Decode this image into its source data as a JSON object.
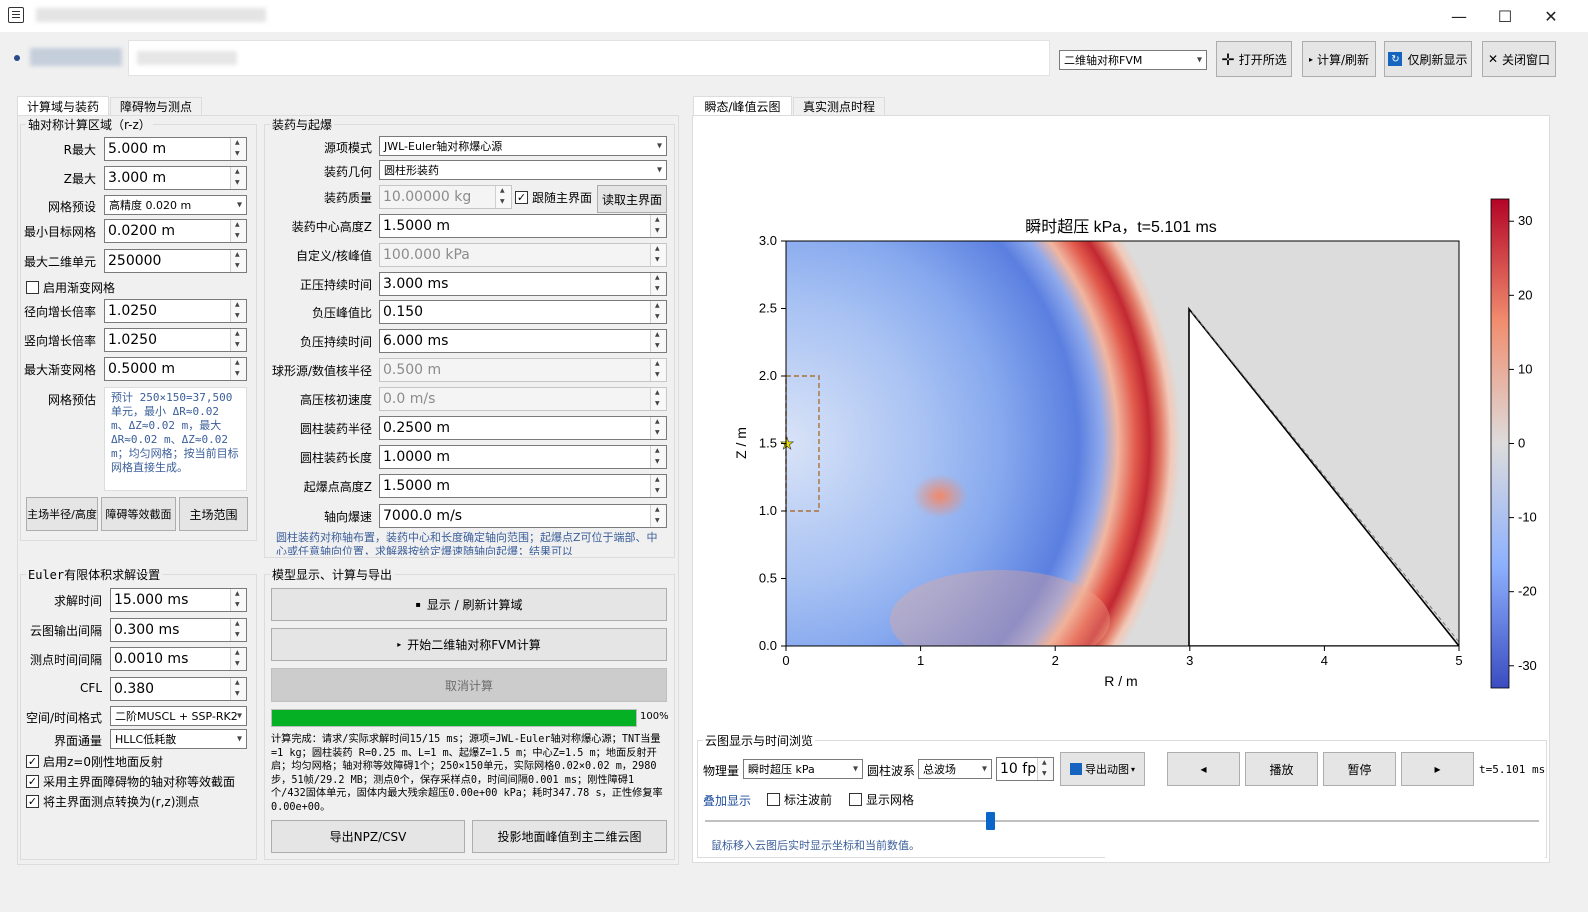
{
  "window": {
    "minimize_glyph": "—",
    "maximize_glyph": "☐",
    "close_glyph": "✕"
  },
  "header": {
    "mode_select": "二维轴对称FVM",
    "open_btn": "打开所选",
    "calc_btn": "计算/刷新",
    "refresh_btn": "仅刷新显示",
    "close_btn": "关闭窗口"
  },
  "left_tabs": [
    "计算域与装药",
    "障碍物与测点"
  ],
  "domain": {
    "title": "轴对称计算区域（r-z）",
    "rmax_label": "R最大",
    "rmax": "5.000 m",
    "zmax_label": "Z最大",
    "zmax": "3.000 m",
    "grid_preset_label": "网格预设",
    "grid_preset": "高精度 0.020 m",
    "min_target_label": "最小目标网格",
    "min_target": "0.0200 m",
    "max_cells_label": "最大二维单元",
    "max_cells": "250000",
    "gradient_check": "启用渐变网格",
    "radial_growth_label": "径向增长倍率",
    "radial_growth": "1.0250",
    "vertical_growth_label": "竖向增长倍率",
    "vertical_growth": "1.0250",
    "max_grad_label": "最大渐变网格",
    "max_grad": "0.5000 m",
    "estimate_label": "网格预估",
    "estimate_text": "预计 250×150=37,500 单元，最小 ΔR≈0.02 m、ΔZ≈0.02 m，最大 ΔR≈0.02 m、ΔZ≈0.02 m；均匀网格；按当前目标网格直接生成。",
    "btn1": "主场半径/高度",
    "btn2": "障碍等效截面",
    "btn3": "主场范围"
  },
  "charge": {
    "title": "装药与起爆",
    "source_label": "源项模式",
    "source": "JWL-Euler轴对称爆心源",
    "geom_label": "装药几何",
    "geom": "圆柱形装药",
    "mass_label": "装药质量",
    "mass": "10.00000 kg",
    "follow_check": "跟随主界面",
    "read_btn": "读取主界面",
    "center_label": "装药中心高度Z",
    "center": "1.5000 m",
    "peak_label": "自定义/核峰值",
    "peak": "100.000 kPa",
    "pos_dur_label": "正压持续时间",
    "pos_dur": "3.000 ms",
    "neg_ratio_label": "负压峰值比",
    "neg_ratio": "0.150",
    "neg_dur_label": "负压持续时间",
    "neg_dur": "6.000 ms",
    "core_r_label": "球形源/数值核半径",
    "core_r": "0.500 m",
    "core_v_label": "高压核初速度",
    "core_v": "0.0 m/s",
    "cyl_r_label": "圆柱装药半径",
    "cyl_r": "0.2500 m",
    "cyl_l_label": "圆柱装药长度",
    "cyl_l": "1.0000 m",
    "det_z_label": "起爆点高度Z",
    "det_z": "1.5000 m",
    "vod_label": "轴向爆速",
    "vod": "7000.0 m/s",
    "note": "圆柱装药对称轴布置，装药中心和长度确定轴向范围；起爆点Z可位于端部、中心或任意轴向位置，求解器按给定爆速随轴向起爆；结果可以"
  },
  "solver": {
    "title": "Euler有限体积求解设置",
    "t_label": "求解时间",
    "t": "15.000 ms",
    "out_label": "云图输出间隔",
    "out": "0.300 ms",
    "probe_label": "测点时间间隔",
    "probe": "0.0010 ms",
    "cfl_label": "CFL",
    "cfl": "0.380",
    "scheme_label": "空间/时间格式",
    "scheme": "二阶MUSCL + SSP-RK2",
    "flux_label": "界面通量",
    "flux": "HLLC低耗散",
    "chk1": "启用z=0刚性地面反射",
    "chk2": "采用主界面障碍物的轴对称等效截面",
    "chk3": "将主界面测点转换为(r,z)测点"
  },
  "model": {
    "title": "模型显示、计算与导出",
    "show_btn": "显示 / 刷新计算域",
    "start_btn": "开始二维轴对称FVM计算",
    "cancel_btn": "取消计算",
    "progress_label": "100%",
    "progress": 1.0,
    "log": "计算完成：请求/实际求解时间15/15 ms；源项=JWL-Euler轴对称爆心源；TNT当量=1 kg；圆柱装药 R=0.25 m、L=1 m、起爆Z=1.5 m；中心Z=1.5 m；地面反射开启；均匀网格；轴对称等效障碍1个；250×150单元，实际网格0.02×0.02 m，2980步，51帧/29.2 MB；测点0个，保存采样点0，时间间隔0.001 ms；刚性障碍1个/432固体单元，固体内最大残余超压0.00e+00 kPa；耗时347.78 s，正性修复率0.00e+00。",
    "export_btn": "导出NPZ/CSV",
    "project_btn": "投影地面峰值到主二维云图"
  },
  "right_tabs": [
    "瞬态/峰值云图",
    "真实测点时程"
  ],
  "chart_data": {
    "type": "heatmap",
    "title": "瞬时超压 kPa，t=5.101 ms",
    "xlabel": "R / m",
    "ylabel": "Z / m",
    "xlim": [
      0,
      5
    ],
    "ylim": [
      0,
      3
    ],
    "xticks": [
      "0",
      "1",
      "2",
      "3",
      "4",
      "5"
    ],
    "yticks": [
      "0.0",
      "0.5",
      "1.0",
      "1.5",
      "2.0",
      "2.5",
      "3.0"
    ],
    "colorbar_ticks": [
      "30",
      "20",
      "10",
      "0",
      "-10",
      "-20",
      "-30"
    ],
    "clim": [
      -33,
      33
    ],
    "shock_front_r": 2.5,
    "obstacle_triangle": [
      [
        3,
        0
      ],
      [
        3,
        2.5
      ],
      [
        5,
        0
      ]
    ],
    "charge_box": {
      "r": [
        0,
        0.25
      ],
      "z": [
        1.0,
        2.0
      ]
    },
    "detonation_point": [
      0,
      1.5
    ]
  },
  "playback": {
    "title": "云图显示与时间浏览",
    "qty_label": "物理量",
    "qty": "瞬时超压 kPa",
    "wave_label": "圆柱波系",
    "wave": "总波场",
    "fps": "10 fps",
    "export_btn": "导出动图",
    "prev_btn": "◂",
    "play_btn": "播放",
    "pause_btn": "暂停",
    "next_btn": "▸",
    "time": "t=5.101 ms",
    "overlay_label": "叠加显示",
    "mark_front": "标注波前",
    "show_grid": "显示网格",
    "slider_pos": 0.34,
    "hint": "鼠标移入云图后实时显示坐标和当前数值。"
  }
}
